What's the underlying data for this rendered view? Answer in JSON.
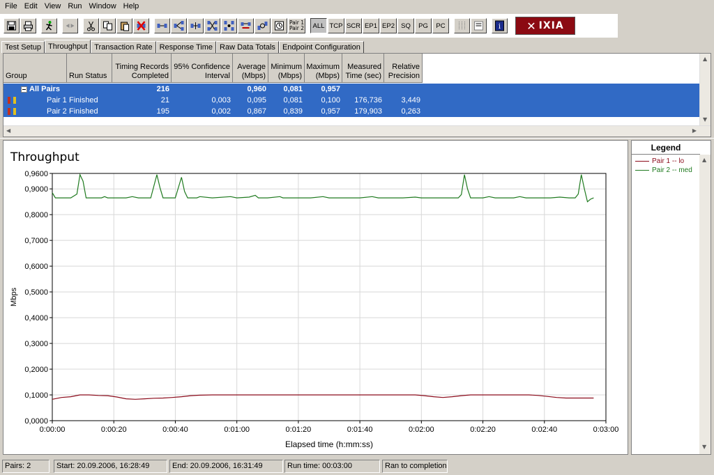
{
  "menu": [
    "File",
    "Edit",
    "View",
    "Run",
    "Window",
    "Help"
  ],
  "toolbar": {
    "text_buttons": [
      "ALL",
      "TCP",
      "SCR",
      "EP1",
      "EP2",
      "SQ",
      "PG",
      "PC"
    ],
    "pair_button": [
      "Pair 1",
      "Pair 2"
    ],
    "logo_text": "IXIA"
  },
  "tabs": [
    "Test Setup",
    "Throughput",
    "Transaction Rate",
    "Response Time",
    "Raw Data Totals",
    "Endpoint Configuration"
  ],
  "active_tab": "Throughput",
  "grid": {
    "headers": [
      "Group",
      "Run Status",
      "Timing Records Completed",
      "95% Confidence Interval",
      "Average (Mbps)",
      "Minimum (Mbps)",
      "Maximum (Mbps)",
      "Measured Time (sec)",
      "Relative Precision"
    ],
    "header_lines": [
      [
        "Group"
      ],
      [
        "Run Status"
      ],
      [
        "Timing Records",
        "Completed"
      ],
      [
        "95% Confidence",
        "Interval"
      ],
      [
        "Average",
        "(Mbps)"
      ],
      [
        "Minimum",
        "(Mbps)"
      ],
      [
        "Maximum",
        "(Mbps)"
      ],
      [
        "Measured",
        "Time (sec)"
      ],
      [
        "Relative",
        "Precision"
      ]
    ],
    "rows": [
      {
        "group": "All Pairs",
        "status": "",
        "records": "216",
        "ci": "",
        "avg": "0,960",
        "min": "0,081",
        "max": "0,957",
        "time": "",
        "precision": ""
      },
      {
        "group": "Pair 1",
        "status": "Finished",
        "records": "21",
        "ci": "0,003",
        "avg": "0,095",
        "min": "0,081",
        "max": "0,100",
        "time": "176,736",
        "precision": "3,449"
      },
      {
        "group": "Pair 2",
        "status": "Finished",
        "records": "195",
        "ci": "0,002",
        "avg": "0,867",
        "min": "0,839",
        "max": "0,957",
        "time": "179,903",
        "precision": "0,263"
      }
    ]
  },
  "chart_data": {
    "type": "line",
    "title": "Throughput",
    "xlabel": "Elapsed time (h:mm:ss)",
    "ylabel": "Mbps",
    "xlim": [
      0,
      180
    ],
    "ylim": [
      0,
      0.96
    ],
    "x_ticks": [
      "0:00:00",
      "0:00:20",
      "0:00:40",
      "0:01:00",
      "0:01:20",
      "0:01:40",
      "0:02:00",
      "0:02:20",
      "0:02:40",
      "0:03:00"
    ],
    "y_ticks": [
      "0,0000",
      "0,1000",
      "0,2000",
      "0,3000",
      "0,4000",
      "0,5000",
      "0,6000",
      "0,7000",
      "0,8000",
      "0,9000",
      "0,9600"
    ],
    "grid": true,
    "legend_position": "right",
    "series": [
      {
        "name": "Pair 1 -- lo",
        "color": "#8b0a1a",
        "points": [
          [
            0,
            0.083
          ],
          [
            3,
            0.09
          ],
          [
            6,
            0.093
          ],
          [
            9,
            0.1
          ],
          [
            12,
            0.1
          ],
          [
            15,
            0.098
          ],
          [
            18,
            0.097
          ],
          [
            21,
            0.092
          ],
          [
            24,
            0.085
          ],
          [
            27,
            0.083
          ],
          [
            30,
            0.085
          ],
          [
            33,
            0.087
          ],
          [
            36,
            0.088
          ],
          [
            39,
            0.09
          ],
          [
            42,
            0.093
          ],
          [
            45,
            0.097
          ],
          [
            48,
            0.099
          ],
          [
            52,
            0.1
          ],
          [
            60,
            0.1
          ],
          [
            70,
            0.1
          ],
          [
            80,
            0.1
          ],
          [
            90,
            0.1
          ],
          [
            100,
            0.1
          ],
          [
            110,
            0.1
          ],
          [
            118,
            0.1
          ],
          [
            121,
            0.097
          ],
          [
            124,
            0.093
          ],
          [
            127,
            0.09
          ],
          [
            130,
            0.093
          ],
          [
            133,
            0.097
          ],
          [
            136,
            0.1
          ],
          [
            145,
            0.1
          ],
          [
            155,
            0.1
          ],
          [
            158,
            0.098
          ],
          [
            161,
            0.094
          ],
          [
            164,
            0.09
          ],
          [
            167,
            0.088
          ],
          [
            170,
            0.088
          ],
          [
            176,
            0.088
          ]
        ]
      },
      {
        "name": "Pair 2 -- med",
        "color": "#1f7a1f",
        "points": [
          [
            0,
            0.885
          ],
          [
            1,
            0.865
          ],
          [
            3,
            0.865
          ],
          [
            6,
            0.865
          ],
          [
            8,
            0.88
          ],
          [
            9,
            0.955
          ],
          [
            10,
            0.93
          ],
          [
            11,
            0.865
          ],
          [
            14,
            0.865
          ],
          [
            16,
            0.865
          ],
          [
            17,
            0.87
          ],
          [
            18,
            0.865
          ],
          [
            20,
            0.865
          ],
          [
            24,
            0.865
          ],
          [
            26,
            0.87
          ],
          [
            28,
            0.865
          ],
          [
            32,
            0.865
          ],
          [
            34,
            0.955
          ],
          [
            35,
            0.905
          ],
          [
            36,
            0.865
          ],
          [
            40,
            0.865
          ],
          [
            42,
            0.945
          ],
          [
            43,
            0.89
          ],
          [
            44,
            0.865
          ],
          [
            47,
            0.865
          ],
          [
            48,
            0.87
          ],
          [
            52,
            0.865
          ],
          [
            58,
            0.87
          ],
          [
            60,
            0.865
          ],
          [
            64,
            0.868
          ],
          [
            66,
            0.875
          ],
          [
            67,
            0.865
          ],
          [
            70,
            0.865
          ],
          [
            74,
            0.87
          ],
          [
            75,
            0.865
          ],
          [
            80,
            0.865
          ],
          [
            84,
            0.865
          ],
          [
            88,
            0.87
          ],
          [
            90,
            0.865
          ],
          [
            96,
            0.865
          ],
          [
            100,
            0.865
          ],
          [
            104,
            0.87
          ],
          [
            106,
            0.865
          ],
          [
            110,
            0.865
          ],
          [
            114,
            0.865
          ],
          [
            118,
            0.868
          ],
          [
            120,
            0.865
          ],
          [
            124,
            0.865
          ],
          [
            128,
            0.865
          ],
          [
            132,
            0.865
          ],
          [
            133,
            0.878
          ],
          [
            134,
            0.955
          ],
          [
            135,
            0.9
          ],
          [
            136,
            0.865
          ],
          [
            140,
            0.865
          ],
          [
            142,
            0.87
          ],
          [
            144,
            0.865
          ],
          [
            148,
            0.865
          ],
          [
            150,
            0.865
          ],
          [
            152,
            0.87
          ],
          [
            154,
            0.865
          ],
          [
            158,
            0.865
          ],
          [
            162,
            0.865
          ],
          [
            165,
            0.868
          ],
          [
            168,
            0.865
          ],
          [
            170,
            0.865
          ],
          [
            171,
            0.88
          ],
          [
            172,
            0.955
          ],
          [
            173,
            0.9
          ],
          [
            174,
            0.85
          ],
          [
            175,
            0.86
          ],
          [
            176,
            0.865
          ]
        ]
      }
    ]
  },
  "status": {
    "pairs": "Pairs: 2",
    "start": "Start: 20.09.2006, 16:28:49",
    "end": "End: 20.09.2006, 16:31:49",
    "run_time": "Run time: 00:03:00",
    "message": "Ran to completion"
  }
}
